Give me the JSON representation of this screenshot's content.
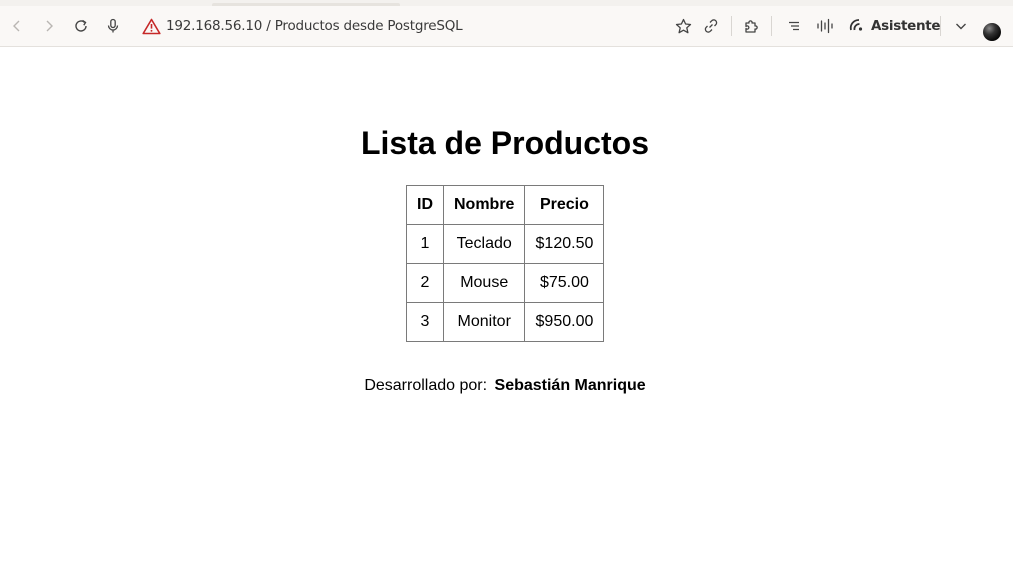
{
  "browser": {
    "url_text": "192.168.56.10 / Productos desde PostgreSQL",
    "assistant_label": "Asistente"
  },
  "page": {
    "title": "Lista de Productos",
    "table": {
      "headers": [
        "ID",
        "Nombre",
        "Precio"
      ],
      "rows": [
        [
          "1",
          "Teclado",
          "$120.50"
        ],
        [
          "2",
          "Mouse",
          "$75.00"
        ],
        [
          "3",
          "Monitor",
          "$950.00"
        ]
      ]
    },
    "footer": {
      "label": "Desarrollado por:",
      "author": "Sebastián Manrique"
    }
  },
  "icons": {
    "back": "back-arrow-icon",
    "forward": "forward-arrow-icon",
    "reload": "reload-icon",
    "voice": "microphone-icon",
    "security": "warning-triangle-icon",
    "bookmark": "star-icon",
    "share": "link-icon",
    "extensions": "puzzle-icon",
    "reader": "reader-mode-icon",
    "audio": "audio-wave-icon",
    "assistant": "assistant-icon",
    "menu": "chevron-down-icon"
  },
  "colors": {
    "warning": "#c62828",
    "toolbar_bg": "#faf8f6"
  }
}
